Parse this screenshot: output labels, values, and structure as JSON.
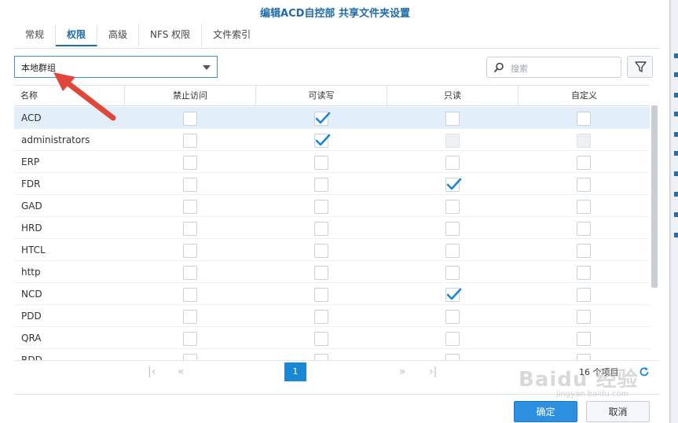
{
  "window": {
    "title": "编辑ACD自控部 共享文件夹设置"
  },
  "tabs": [
    {
      "label": "常规",
      "active": false
    },
    {
      "label": "权限",
      "active": true
    },
    {
      "label": "高级",
      "active": false
    },
    {
      "label": "NFS 权限",
      "active": false
    },
    {
      "label": "文件索引",
      "active": false
    }
  ],
  "toolbar": {
    "group_select_value": "本地群组",
    "search_placeholder": "搜索",
    "search_icon": "search-icon",
    "filter_icon": "filter-icon"
  },
  "table": {
    "columns": [
      "名称",
      "禁止访问",
      "可读写",
      "只读",
      "自定义"
    ],
    "rows": [
      {
        "name": "ACD",
        "deny": false,
        "rw": true,
        "ro": false,
        "custom": false,
        "selected": true
      },
      {
        "name": "administrators",
        "deny": false,
        "rw": true,
        "ro": false,
        "custom": false,
        "ro_disabled": true,
        "custom_disabled": true
      },
      {
        "name": "ERP",
        "deny": false,
        "rw": false,
        "ro": false,
        "custom": false
      },
      {
        "name": "FDR",
        "deny": false,
        "rw": false,
        "ro": true,
        "custom": false
      },
      {
        "name": "GAD",
        "deny": false,
        "rw": false,
        "ro": false,
        "custom": false
      },
      {
        "name": "HRD",
        "deny": false,
        "rw": false,
        "ro": false,
        "custom": false
      },
      {
        "name": "HTCL",
        "deny": false,
        "rw": false,
        "ro": false,
        "custom": false
      },
      {
        "name": "http",
        "deny": false,
        "rw": false,
        "ro": false,
        "custom": false
      },
      {
        "name": "NCD",
        "deny": false,
        "rw": false,
        "ro": true,
        "custom": false
      },
      {
        "name": "PDD",
        "deny": false,
        "rw": false,
        "ro": false,
        "custom": false
      },
      {
        "name": "QRA",
        "deny": false,
        "rw": false,
        "ro": false,
        "custom": false
      },
      {
        "name": "RDD",
        "deny": false,
        "rw": false,
        "ro": false,
        "custom": false
      }
    ]
  },
  "pager": {
    "first": "|‹",
    "prev": "«",
    "current_page": "1",
    "next": "»",
    "last": "›|",
    "item_count": "16 个项目"
  },
  "buttons": {
    "ok": "确定",
    "cancel": "取消"
  },
  "watermark": {
    "main": "Baidu 经验",
    "sub": "jingyan.baidu.com"
  },
  "colors": {
    "accent": "#1c86d6",
    "title": "#1f6ba8",
    "arrow": "#e0463a",
    "selected_row": "#e3eefb"
  }
}
